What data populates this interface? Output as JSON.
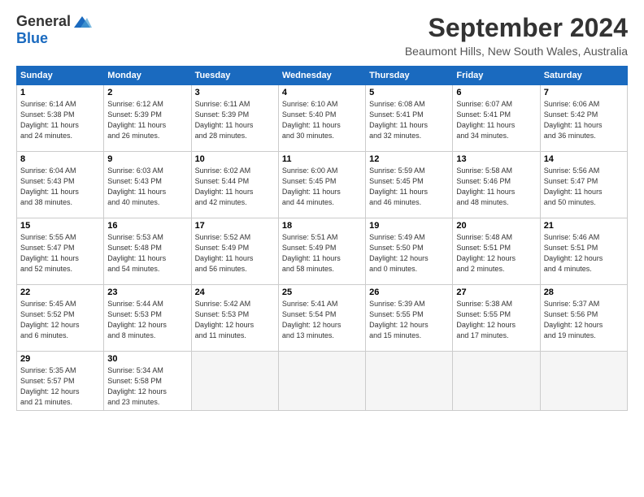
{
  "logo": {
    "general": "General",
    "blue": "Blue"
  },
  "title": "September 2024",
  "location": "Beaumont Hills, New South Wales, Australia",
  "headers": [
    "Sunday",
    "Monday",
    "Tuesday",
    "Wednesday",
    "Thursday",
    "Friday",
    "Saturday"
  ],
  "weeks": [
    [
      {
        "day": "1",
        "info": "Sunrise: 6:14 AM\nSunset: 5:38 PM\nDaylight: 11 hours\nand 24 minutes."
      },
      {
        "day": "2",
        "info": "Sunrise: 6:12 AM\nSunset: 5:39 PM\nDaylight: 11 hours\nand 26 minutes."
      },
      {
        "day": "3",
        "info": "Sunrise: 6:11 AM\nSunset: 5:39 PM\nDaylight: 11 hours\nand 28 minutes."
      },
      {
        "day": "4",
        "info": "Sunrise: 6:10 AM\nSunset: 5:40 PM\nDaylight: 11 hours\nand 30 minutes."
      },
      {
        "day": "5",
        "info": "Sunrise: 6:08 AM\nSunset: 5:41 PM\nDaylight: 11 hours\nand 32 minutes."
      },
      {
        "day": "6",
        "info": "Sunrise: 6:07 AM\nSunset: 5:41 PM\nDaylight: 11 hours\nand 34 minutes."
      },
      {
        "day": "7",
        "info": "Sunrise: 6:06 AM\nSunset: 5:42 PM\nDaylight: 11 hours\nand 36 minutes."
      }
    ],
    [
      {
        "day": "8",
        "info": "Sunrise: 6:04 AM\nSunset: 5:43 PM\nDaylight: 11 hours\nand 38 minutes."
      },
      {
        "day": "9",
        "info": "Sunrise: 6:03 AM\nSunset: 5:43 PM\nDaylight: 11 hours\nand 40 minutes."
      },
      {
        "day": "10",
        "info": "Sunrise: 6:02 AM\nSunset: 5:44 PM\nDaylight: 11 hours\nand 42 minutes."
      },
      {
        "day": "11",
        "info": "Sunrise: 6:00 AM\nSunset: 5:45 PM\nDaylight: 11 hours\nand 44 minutes."
      },
      {
        "day": "12",
        "info": "Sunrise: 5:59 AM\nSunset: 5:45 PM\nDaylight: 11 hours\nand 46 minutes."
      },
      {
        "day": "13",
        "info": "Sunrise: 5:58 AM\nSunset: 5:46 PM\nDaylight: 11 hours\nand 48 minutes."
      },
      {
        "day": "14",
        "info": "Sunrise: 5:56 AM\nSunset: 5:47 PM\nDaylight: 11 hours\nand 50 minutes."
      }
    ],
    [
      {
        "day": "15",
        "info": "Sunrise: 5:55 AM\nSunset: 5:47 PM\nDaylight: 11 hours\nand 52 minutes."
      },
      {
        "day": "16",
        "info": "Sunrise: 5:53 AM\nSunset: 5:48 PM\nDaylight: 11 hours\nand 54 minutes."
      },
      {
        "day": "17",
        "info": "Sunrise: 5:52 AM\nSunset: 5:49 PM\nDaylight: 11 hours\nand 56 minutes."
      },
      {
        "day": "18",
        "info": "Sunrise: 5:51 AM\nSunset: 5:49 PM\nDaylight: 11 hours\nand 58 minutes."
      },
      {
        "day": "19",
        "info": "Sunrise: 5:49 AM\nSunset: 5:50 PM\nDaylight: 12 hours\nand 0 minutes."
      },
      {
        "day": "20",
        "info": "Sunrise: 5:48 AM\nSunset: 5:51 PM\nDaylight: 12 hours\nand 2 minutes."
      },
      {
        "day": "21",
        "info": "Sunrise: 5:46 AM\nSunset: 5:51 PM\nDaylight: 12 hours\nand 4 minutes."
      }
    ],
    [
      {
        "day": "22",
        "info": "Sunrise: 5:45 AM\nSunset: 5:52 PM\nDaylight: 12 hours\nand 6 minutes."
      },
      {
        "day": "23",
        "info": "Sunrise: 5:44 AM\nSunset: 5:53 PM\nDaylight: 12 hours\nand 8 minutes."
      },
      {
        "day": "24",
        "info": "Sunrise: 5:42 AM\nSunset: 5:53 PM\nDaylight: 12 hours\nand 11 minutes."
      },
      {
        "day": "25",
        "info": "Sunrise: 5:41 AM\nSunset: 5:54 PM\nDaylight: 12 hours\nand 13 minutes."
      },
      {
        "day": "26",
        "info": "Sunrise: 5:39 AM\nSunset: 5:55 PM\nDaylight: 12 hours\nand 15 minutes."
      },
      {
        "day": "27",
        "info": "Sunrise: 5:38 AM\nSunset: 5:55 PM\nDaylight: 12 hours\nand 17 minutes."
      },
      {
        "day": "28",
        "info": "Sunrise: 5:37 AM\nSunset: 5:56 PM\nDaylight: 12 hours\nand 19 minutes."
      }
    ],
    [
      {
        "day": "29",
        "info": "Sunrise: 5:35 AM\nSunset: 5:57 PM\nDaylight: 12 hours\nand 21 minutes."
      },
      {
        "day": "30",
        "info": "Sunrise: 5:34 AM\nSunset: 5:58 PM\nDaylight: 12 hours\nand 23 minutes."
      },
      {
        "day": "",
        "info": ""
      },
      {
        "day": "",
        "info": ""
      },
      {
        "day": "",
        "info": ""
      },
      {
        "day": "",
        "info": ""
      },
      {
        "day": "",
        "info": ""
      }
    ]
  ]
}
